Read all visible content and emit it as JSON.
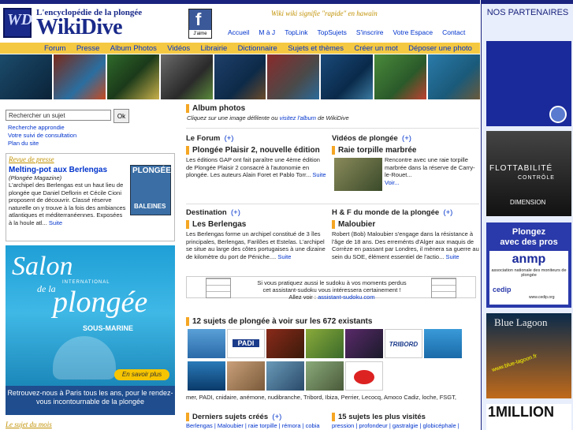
{
  "logo": {
    "sub": "L'encyclopédie de la plongée",
    "title": "WikiDive",
    "mono": "WD"
  },
  "facebook": {
    "letter": "f",
    "label": "J'aime"
  },
  "tagline": "Wiki wiki signifie \"rapide\" en hawaïn",
  "toplinks": [
    "Accueil",
    "M à J",
    "TopLink",
    "TopSujets",
    "S'inscrire",
    "Votre Espace",
    "Contact"
  ],
  "menu": [
    "Forum",
    "Presse",
    "Album Photos",
    "Vidéos",
    "Librairie",
    "Dictionnaire",
    "Sujets et thèmes",
    "Créer un mot",
    "Déposer une photo"
  ],
  "search": {
    "value": "Rechercher un sujet",
    "button": "Ok",
    "links": [
      "Recherche approndie",
      "Votre suivi de consultation",
      "Plan du site"
    ]
  },
  "press": {
    "heading": "Revue de presse",
    "title": "Melting-pot aux Berlengas",
    "source": "(Plongée Magazine)",
    "body": "L'archipel des Berlengas est un haut lieu de plongée que Daniel Deflorin et Cécile Cioni proposent de découvrir. Classé réserve naturelle on y trouve à la fois des ambiances atlantiques et méditerranéennes. Exposées à la houle atl...",
    "more": "Suite",
    "mag_title": "PLONGÉE",
    "mag_sub": "BALEINES"
  },
  "salon": {
    "l1": "Salon",
    "l2": "de la",
    "l3": "plongée",
    "l4": "SOUS-MARINE",
    "international": "INTERNATIONAL",
    "button": "En savoir plus",
    "bottom": "Retrouvez-nous à Paris tous les ans, pour le rendez-vous incontournable de la plongée"
  },
  "sujet_mois": "Le sujet du mois",
  "album": {
    "title": "Album photos",
    "sub_a": "Cliquez sur une image défilente ou ",
    "sub_link": "visitez l'album",
    "sub_b": " de WikiDive"
  },
  "forum": {
    "head": "Le Forum",
    "plus": "(+)",
    "title": "Plongée Plaisir 2, nouvelle édition",
    "body": "Les éditions GAP ont fait paraître une 4ème édition de Plongée Plaisir 2 consacré à l'autonomie en plongée. Les auteurs Alain Foret et Pablo Torr...",
    "more": "Suite"
  },
  "videos": {
    "head": "Vidéos de plongée",
    "plus": "(+)",
    "title": "Raie torpille marbrée",
    "body": "Rencontre avec une raie torpille marbrée dans la réserve de Carry-le-Rouet...",
    "more": "Voir..."
  },
  "destination": {
    "head": "Destination",
    "plus": "(+)",
    "title": "Les Berlengas",
    "body": "Les Berlengas forme un archipel constitué de 3 îles principales, Berlengas, Farilões et Estelas. L'archipel se situe au large des côtes portugaises à une dizaine de kilomètre du port de Péniche....",
    "more": "Suite"
  },
  "hf": {
    "head": "H & F du monde de la plongée",
    "plus": "(+)",
    "title": "Maloubier",
    "body": "Robert (Bob) Maloubier s'engage dans la résistance à l'âge de 18 ans. Des erreménts d'Alger aux maquis de Corrèze en passant par Londres, il mènera sa guerre au sein du SOE, élément essentiel de l'actio...",
    "more": "Suite"
  },
  "sudoku": {
    "l1": "Si vous pratiquez aussi le sudoku à vos moments perdus",
    "l2": "cet assistant-sudoku vous intéressera certainement !",
    "l3a": "Allez voir : ",
    "l3link": "assistant-sudoku.com"
  },
  "sujets12": {
    "title": "12 sujets de plongée à voir sur les 672 existants"
  },
  "tags": "mer, PADI, cnidaire, anémone, nudibranche, Tribord, Ibiza, Perrier, Lecocq, Amoco Cadiz, loche, FSGT,",
  "derniers": {
    "head": "Derniers sujets créés",
    "plus": "(+)",
    "items": "Berlengas | Maloubier | raie torpille | rémora | cobia"
  },
  "visites": {
    "head": "15 sujets les plus visités",
    "items": "pression | profondeur | gastralgie | globicéphale |"
  },
  "right": {
    "title": "NOS PARTENAIRES",
    "ad2_a": "FLOTTABILITÉ",
    "ad2_b": "CONTRÔLE",
    "ad2_c": "DIMENSION",
    "ad3_a": "Plongez",
    "ad3_b": "avec des pros",
    "ad3_c": "anmp",
    "ad3_d": "association nationale des moniteurs de plongée",
    "ad3_e": "cedip",
    "ad3_f": "www.cedip.org",
    "ad4": "Blue Lagoon",
    "ad4_sub": "www.blue-lagoon.fr",
    "ad5": "1MILLION"
  },
  "colors": {
    "accent": "#f5c842",
    "nav": "#1a237e",
    "link": "#0033cc",
    "gold": "#c09000"
  }
}
